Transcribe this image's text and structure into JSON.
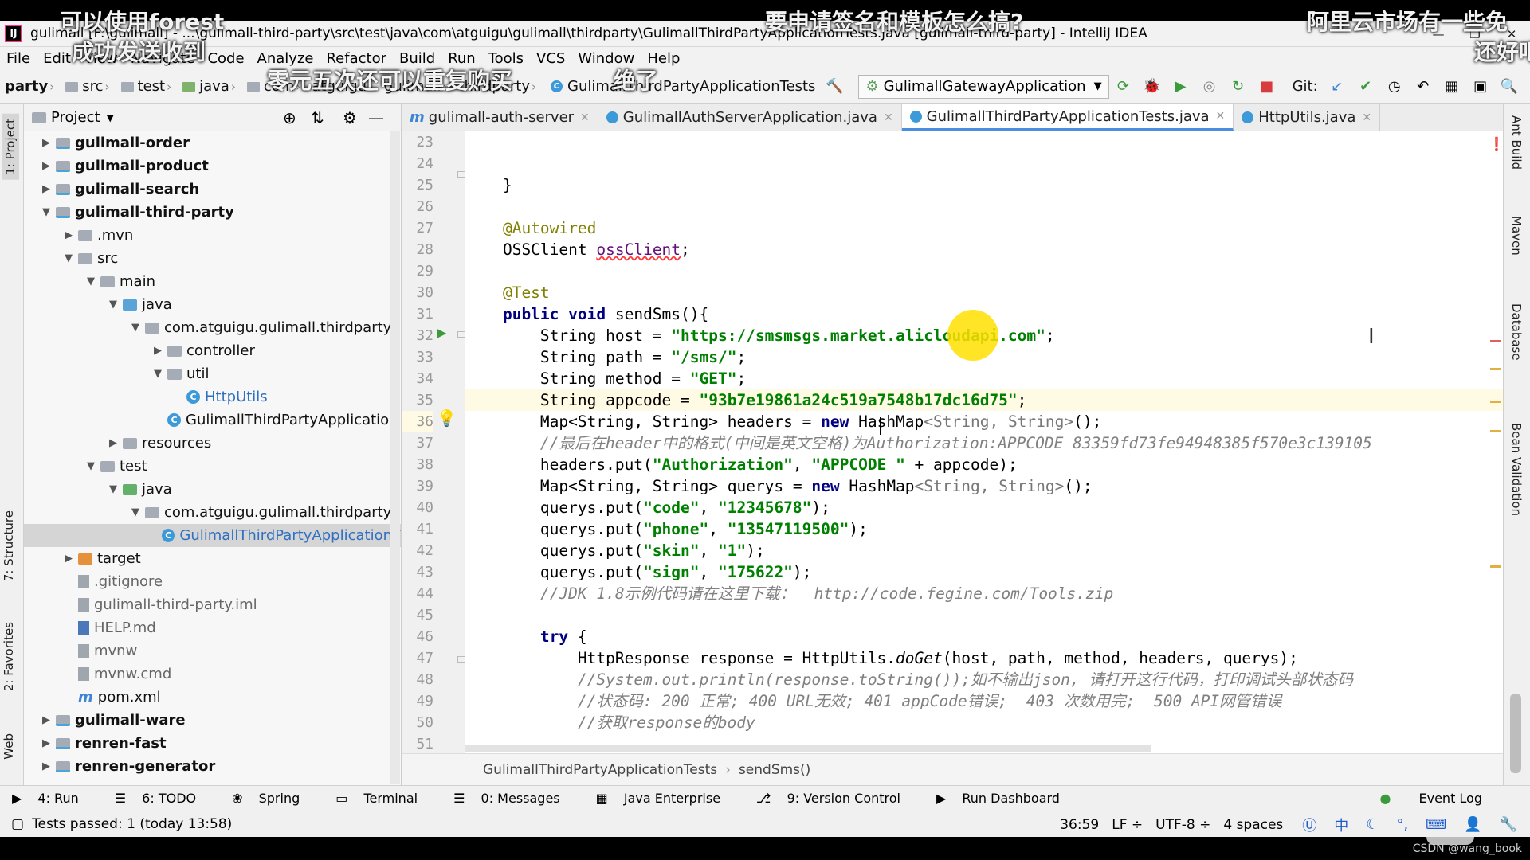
{
  "window": {
    "title": "gulimall [F:\\gulimall] - ...\\gulimall-third-party\\src\\test\\java\\com\\atguigu\\gulimall\\thirdparty\\GulimallThirdPartyApplicationTests.java [gulimall-third-party] - IntelliJ IDEA"
  },
  "menu": [
    "File",
    "Edit",
    "View",
    "Navigate",
    "Code",
    "Analyze",
    "Refactor",
    "Build",
    "Run",
    "Tools",
    "VCS",
    "Window",
    "Help"
  ],
  "nav": {
    "crumbs": [
      "party",
      "src",
      "test",
      "java",
      "com",
      "atguigu",
      "gulimall",
      "thirdparty",
      "GulimallThirdPartyApplicationTests"
    ],
    "run_config": "GulimallGatewayApplication",
    "git_label": "Git:"
  },
  "left_tabs": [
    "1: Project",
    "7: Structure",
    "2: Favorites",
    "Web"
  ],
  "right_tabs": [
    "Ant Build",
    "Maven",
    "Database",
    "Bean Validation"
  ],
  "project": {
    "header": "Project",
    "tree": [
      "gulimall-order",
      "gulimall-product",
      "gulimall-search",
      "gulimall-third-party",
      ".mvn",
      "src",
      "main",
      "java",
      "com.atguigu.gulimall.thirdparty",
      "controller",
      "util",
      "HttpUtils",
      "GulimallThirdPartyApplication",
      "resources",
      "test",
      "java",
      "com.atguigu.gulimall.thirdparty",
      "GulimallThirdPartyApplicationT",
      "target",
      ".gitignore",
      "gulimall-third-party.iml",
      "HELP.md",
      "mvnw",
      "mvnw.cmd",
      "pom.xml",
      "gulimall-ware",
      "renren-fast",
      "renren-generator"
    ]
  },
  "tabs": [
    "gulimall-auth-server",
    "GulimallAuthServerApplication.java",
    "GulimallThirdPartyApplicationTests.java",
    "HttpUtils.java"
  ],
  "code": {
    "line_numbers": [
      "23",
      "24",
      "25",
      "26",
      "27",
      "28",
      "29",
      "30",
      "31",
      "32",
      "33",
      "34",
      "35",
      "36",
      "37",
      "38",
      "39",
      "40",
      "41",
      "42",
      "43",
      "44",
      "45",
      "46",
      "47",
      "48",
      "49",
      "50",
      "51"
    ],
    "l25": "    }",
    "l27": "    @Autowired",
    "l28a": "    OSSClient ",
    "l28b": "ossClient",
    "l28c": ";",
    "l31": "    @Test",
    "l32a": "    public void",
    "l32b": " sendSms(){",
    "l33a": "        String host = ",
    "l33b": "\"https://smsmsgs.market.alicloudapi.com\"",
    "l33c": ";",
    "l34a": "        String path = ",
    "l34b": "\"/sms/\"",
    "l34c": ";",
    "l35a": "        String method = ",
    "l35b": "\"GET\"",
    "l35c": ";",
    "l36a": "        String appcode = ",
    "l36b": "\"93b7e19861a24c519a7548b17dc16d75\"",
    "l36c": ";",
    "l37a": "        Map<String, String> headers = ",
    "l37b": "new",
    "l37c": " HashMap",
    "l37d": "<String, String>",
    "l37e": "();",
    "l38": "        //最后在header中的格式(中间是英文空格)为Authorization:APPCODE 83359fd73fe94948385f570e3c139105",
    "l39a": "        headers.put(",
    "l39b": "\"Authorization\"",
    "l39c": ", ",
    "l39d": "\"APPCODE \"",
    "l39e": " + appcode);",
    "l40a": "        Map<String, String> querys = ",
    "l40b": "new",
    "l40c": " HashMap",
    "l40d": "<String, String>",
    "l40e": "();",
    "l41a": "        querys.put(",
    "l41b": "\"code\"",
    "l41c": ", ",
    "l41d": "\"12345678\"",
    "l41e": ");",
    "l42a": "        querys.put(",
    "l42b": "\"phone\"",
    "l42c": ", ",
    "l42d": "\"13547119500\"",
    "l42e": ");",
    "l43a": "        querys.put(",
    "l43b": "\"skin\"",
    "l43c": ", ",
    "l43d": "\"1\"",
    "l43e": ");",
    "l44a": "        querys.put(",
    "l44b": "\"sign\"",
    "l44c": ", ",
    "l44d": "\"175622\"",
    "l44e": ");",
    "l45a": "        //JDK 1.8示例代码请在这里下载：  ",
    "l45b": "http://code.fegine.com/Tools.zip",
    "l47a": "        try",
    "l47b": " {",
    "l48a": "            HttpResponse response = HttpUtils.",
    "l48b": "doGet",
    "l48c": "(host, path, method, headers, querys);",
    "l49": "            //System.out.println(response.toString());如不输出json, 请打开这行代码，打印调试头部状态码",
    "l50": "            //状态码: 200 正常; 400 URL无效; 401 appCode错误;  403 次数用完;  500 API网管错误",
    "l51": "            //获取response的body"
  },
  "editor_breadcrumb": [
    "GulimallThirdPartyApplicationTests",
    "sendSms()"
  ],
  "bottom_tools": [
    "4: Run",
    "6: TODO",
    "Spring",
    "Terminal",
    "0: Messages",
    "Java Enterprise",
    "9: Version Control",
    "Run Dashboard",
    "Event Log"
  ],
  "status": {
    "message": "Tests passed: 1 (today 13:58)",
    "position": "36:59",
    "line_sep": "LF ÷",
    "encoding": "UTF-8 ÷",
    "indent": "4 spaces",
    "ime": "中"
  },
  "overlays": {
    "o1": "可以使用forest",
    "o2": "成功发送收到",
    "o3": "零元五次还可以重复购买",
    "o4": "绝了",
    "o5": "要申请签名和模板怎么搞?",
    "o6": "阿里云市场有一些免",
    "o7": "还好吧"
  },
  "watermark": "CSDN @wang_book",
  "colors": {
    "keyword": "#000080",
    "string": "#008000",
    "annotation": "#808000",
    "comment": "#808080",
    "accent": "#4b8ee0"
  }
}
